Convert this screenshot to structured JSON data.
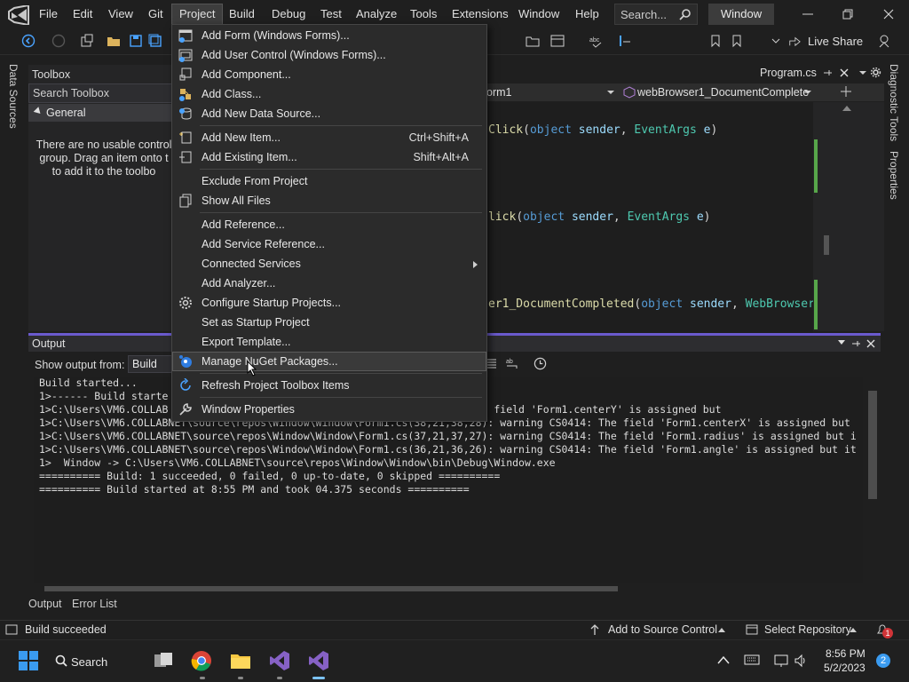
{
  "menubar": {
    "items": [
      "File",
      "Edit",
      "View",
      "Git",
      "Project",
      "Build",
      "Debug",
      "Test",
      "Analyze",
      "Tools",
      "Extensions",
      "Window",
      "Help"
    ],
    "active": "Project",
    "search_placeholder": "Search...",
    "window_title": "Window"
  },
  "toolbar": {
    "live_share": "Live Share"
  },
  "left_rail": {
    "label": "Data Sources"
  },
  "right_rail": {
    "diagnostic_tools": "Diagnostic Tools",
    "properties": "Properties"
  },
  "toolbox": {
    "title": "Toolbox",
    "search_placeholder": "Search Toolbox",
    "group": "General",
    "message_lines": [
      "There are no usable control",
      "group. Drag an item onto t",
      "to add it to the toolbo"
    ]
  },
  "editor": {
    "tab": "Program.cs",
    "nav_left": "orm1",
    "nav_right": "webBrowser1_DocumentComplete",
    "code_lines": [
      {
        "fn": "Click",
        "rest": "(object sender, EventArgs e)"
      },
      {
        "fn": "lick",
        "rest": "(object sender, EventArgs e)"
      },
      {
        "fn": "er1_DocumentCompleted",
        "rest": "(object sender, WebBrowserDo"
      }
    ]
  },
  "output": {
    "title": "Output",
    "show_from_label": "Show output from:",
    "source": "Build",
    "lines": [
      "Build started...",
      "1>------ Build starte                                          ------",
      "1>C:\\Users\\VM6.COLLAB                              ): warning CS0414: The field 'Form1.centerY' is assigned but",
      "1>C:\\Users\\VM6.COLLABNET\\source\\repos\\Window\\Window\\Form1.cs(38,21,38,28): warning CS0414: The field 'Form1.centerX' is assigned but",
      "1>C:\\Users\\VM6.COLLABNET\\source\\repos\\Window\\Window\\Form1.cs(37,21,37,27): warning CS0414: The field 'Form1.radius' is assigned but i",
      "1>C:\\Users\\VM6.COLLABNET\\source\\repos\\Window\\Window\\Form1.cs(36,21,36,26): warning CS0414: The field 'Form1.angle' is assigned but it",
      "1>  Window -> C:\\Users\\VM6.COLLABNET\\source\\repos\\Window\\Window\\bin\\Debug\\Window.exe",
      "========== Build: 1 succeeded, 0 failed, 0 up-to-date, 0 skipped ==========",
      "========== Build started at 8:55 PM and took 04.375 seconds =========="
    ]
  },
  "bottom_tabs": [
    "Output",
    "Error List"
  ],
  "statusbar": {
    "left": "Build succeeded",
    "source_control": "Add to Source Control",
    "repository": "Select Repository",
    "notifications": "1"
  },
  "taskbar": {
    "search": "Search",
    "time": "8:56 PM",
    "date": "5/2/2023",
    "badge": "2"
  },
  "project_menu": {
    "items": [
      {
        "label": "Add Form (Windows Forms)...",
        "icon": "form-icon"
      },
      {
        "label": "Add User Control (Windows Forms)...",
        "icon": "user-control-icon"
      },
      {
        "label": "Add Component...",
        "icon": "component-icon"
      },
      {
        "label": "Add Class...",
        "icon": "class-icon"
      },
      {
        "label": "Add New Data Source...",
        "icon": "data-source-icon"
      },
      {
        "label": "Add New Item...",
        "shortcut": "Ctrl+Shift+A",
        "icon": "new-item-icon"
      },
      {
        "label": "Add Existing Item...",
        "shortcut": "Shift+Alt+A",
        "icon": "existing-item-icon"
      },
      {
        "label": "Exclude From Project"
      },
      {
        "label": "Show All Files",
        "icon": "show-all-files-icon"
      },
      {
        "label": "Add Reference..."
      },
      {
        "label": "Add Service Reference..."
      },
      {
        "label": "Connected Services",
        "submenu": true
      },
      {
        "label": "Add Analyzer..."
      },
      {
        "label": "Configure Startup Projects...",
        "icon": "gear-icon"
      },
      {
        "label": "Set as Startup Project"
      },
      {
        "label": "Export Template..."
      },
      {
        "label": "Manage NuGet Packages...",
        "icon": "nuget-icon",
        "hovered": true
      },
      {
        "label": "Refresh Project Toolbox Items",
        "icon": "refresh-icon"
      },
      {
        "label": "Window Properties",
        "icon": "wrench-icon"
      }
    ]
  },
  "colors": {
    "accent": "#7160e8",
    "menu_bg": "#2b2b2b",
    "background": "#1f1f1f"
  }
}
